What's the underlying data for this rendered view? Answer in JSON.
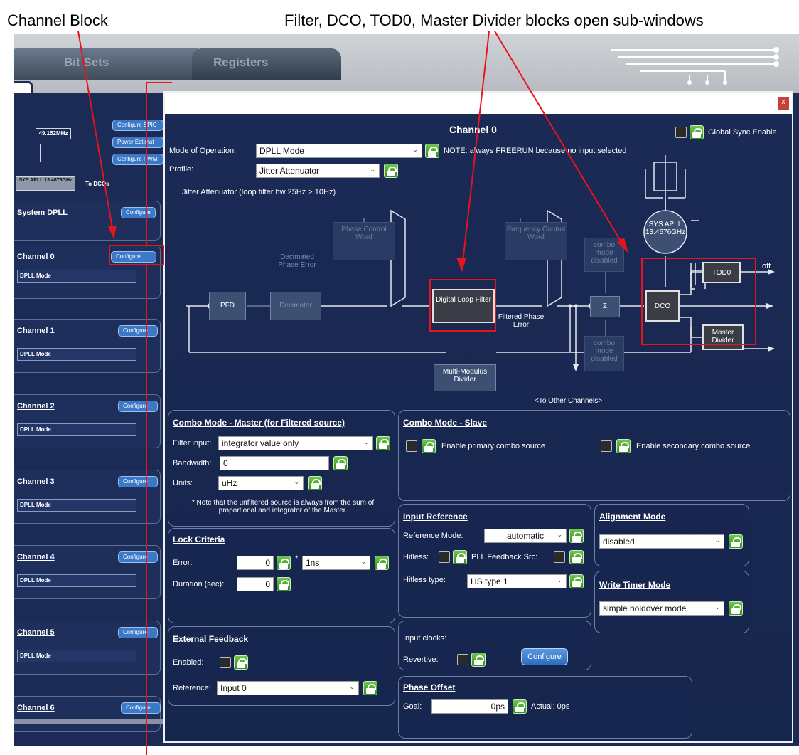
{
  "annotations": {
    "left": "Channel Block",
    "right": "Filter, DCO, TOD0, Master Divider blocks open sub-windows"
  },
  "tabs": [
    "Bit Sets",
    "Registers"
  ],
  "sidebar": {
    "freq": "49.152MHz",
    "apll": "SYS APLL 13.4676GHz",
    "to_dcos": "To DCOs",
    "buttons": [
      "Configure SPIC",
      "Power Estimat",
      "Configure PWM"
    ],
    "blocks": [
      {
        "title": "System DPLL",
        "btn": "Configure",
        "mode": ""
      },
      {
        "title": "Channel 0",
        "btn": "Configure",
        "mode": "DPLL Mode"
      },
      {
        "title": "Channel 1",
        "btn": "Configure",
        "mode": "DPLL Mode"
      },
      {
        "title": "Channel 2",
        "btn": "Configure",
        "mode": "DPLL Mode"
      },
      {
        "title": "Channel 3",
        "btn": "Configure",
        "mode": "DPLL Mode"
      },
      {
        "title": "Channel 4",
        "btn": "Configure",
        "mode": "DPLL Mode"
      },
      {
        "title": "Channel 5",
        "btn": "Configure",
        "mode": "DPLL Mode"
      },
      {
        "title": "Channel 6",
        "btn": "Configure",
        "mode": ""
      }
    ]
  },
  "dialog": {
    "close": "x",
    "title": "Channel 0",
    "global_sync": "Global Sync Enable",
    "mode_label": "Mode of Operation:",
    "mode_value": "DPLL Mode",
    "note": "NOTE: always FREERUN because no input selected",
    "profile_label": "Profile:",
    "profile_value": "Jitter Attenuator",
    "profile_desc": "Jitter Attenuator (loop filter bw 25Hz > 10Hz)",
    "diagram": {
      "pfd": "PFD",
      "decimator": "Decimator",
      "decimated": "Decimated Phase Error",
      "phase_cw": "Phase Control Word",
      "dlf": "Digital Loop Filter",
      "filtered": "Filtered Phase Error",
      "freq_cw": "Frequency Control Word",
      "combo_top": "combo mode disabled",
      "combo_bottom": "combo mode disabled",
      "sigma": "Σ",
      "dco": "DCO",
      "sys_apll": "SYS APLL 13.4676GHz",
      "tod0": "TOD0",
      "off": "off",
      "master_div": "Master Divider",
      "mmd": "Multi-Modulus Divider",
      "other": "<To Other Channels>"
    },
    "combo_master": {
      "title": "Combo Mode - Master (for Filtered source)",
      "filter_label": "Filter input:",
      "filter_value": "integrator value only",
      "bw_label": "Bandwidth:",
      "bw_value": "0",
      "units_label": "Units:",
      "units_value": "uHz",
      "note": "* Note that the unfiltered source is always from the sum of proportional and integrator of the Master."
    },
    "combo_slave": {
      "title": "Combo Mode - Slave",
      "primary": "Enable primary combo source",
      "secondary": "Enable secondary combo source"
    },
    "lock": {
      "title": "Lock Criteria",
      "error_label": "Error:",
      "error_value": "0",
      "star": "*",
      "error_unit": "1ns",
      "dur_label": "Duration (sec):",
      "dur_value": "0"
    },
    "ext_fb": {
      "title": "External Feedback",
      "enabled": "Enabled:",
      "ref_label": "Reference:",
      "ref_value": "Input 0"
    },
    "input_ref": {
      "title": "Input Reference",
      "mode_label": "Reference Mode:",
      "mode_value": "automatic",
      "hitless": "Hitless:",
      "pll_fb": "PLL Feedback Src:",
      "hitless_type_label": "Hitless type:",
      "hitless_type_value": "HS type 1"
    },
    "input_clocks": {
      "label": "Input clocks:",
      "revertive": "Revertive:",
      "configure": "Configure"
    },
    "phase_offset": {
      "title": "Phase Offset",
      "goal_label": "Goal:",
      "goal_value": "0ps",
      "actual": "Actual: 0ps"
    },
    "alignment": {
      "title": "Alignment Mode",
      "value": "disabled"
    },
    "write_timer": {
      "title": "Write Timer Mode",
      "value": "simple holdover mode"
    }
  }
}
